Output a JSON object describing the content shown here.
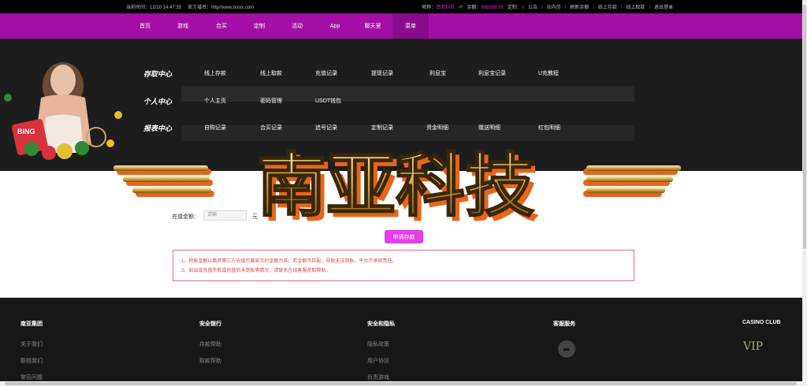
{
  "topbar": {
    "time_label": "当前时间：",
    "time_value": "12/10 14:47:35",
    "domain_label": "官方域名：",
    "domain_value": "http//www.lxxxx.com",
    "nickname_label": "昵称：",
    "nickname_value": "南亚科技",
    "balance_label": "余额：",
    "balance_value": "999999.99",
    "custom_label": "定制：",
    "custom_value": "0",
    "links": [
      "公告",
      "站内信",
      "刷新余额",
      "线上存款",
      "线上取款",
      "退出登录"
    ]
  },
  "nav": {
    "items": [
      "首页",
      "游戏",
      "合买",
      "定制",
      "活动",
      "App",
      "聊天室",
      "菜单"
    ]
  },
  "mega": {
    "rows": [
      {
        "title": "存取中心",
        "links": [
          "线上存款",
          "线上取款",
          "充值记录",
          "提现记录",
          "利息宝",
          "利息宝记录",
          "U充教程"
        ]
      },
      {
        "title": "个人中心",
        "links": [
          "个人主页",
          "密码管理",
          "USDT钱包"
        ]
      },
      {
        "title": "报表中心",
        "links": [
          "自购记录",
          "合买记录",
          "追号记录",
          "定制记录",
          "资金明细",
          "赠送明细",
          "红包明细"
        ]
      }
    ]
  },
  "deposit": {
    "amount_label": "充值金额：",
    "amount_placeholder": "请输",
    "unit": "元",
    "submit_label": "申请存款",
    "notices": [
      "1、转账金额以跳转第三方充值页面显示的金额为准，若金额不匹配，导致无法到账，平台不承担责任。",
      "2、如出现充值失败或充值后未到账等情况，请联系在线客服获取帮助。"
    ]
  },
  "logo": {
    "text": "南亚科技"
  },
  "footer": {
    "columns": [
      {
        "heading": "南亚集团",
        "links": [
          "关于我们",
          "联络我们",
          "常见问题"
        ]
      },
      {
        "heading": "安全银行",
        "links": [
          "存款帮助",
          "取款帮助"
        ]
      },
      {
        "heading": "安全和隐私",
        "links": [
          "隐私政策",
          "用户协议",
          "负责游戏"
        ]
      },
      {
        "heading": "客服服务",
        "links": []
      },
      {
        "heading": "CASINO CLUB",
        "links": []
      }
    ],
    "vip_text": "VIP"
  },
  "colors": {
    "accent": "#a30fa6",
    "button": "#e23fe6",
    "notice": "#e04a4a"
  }
}
